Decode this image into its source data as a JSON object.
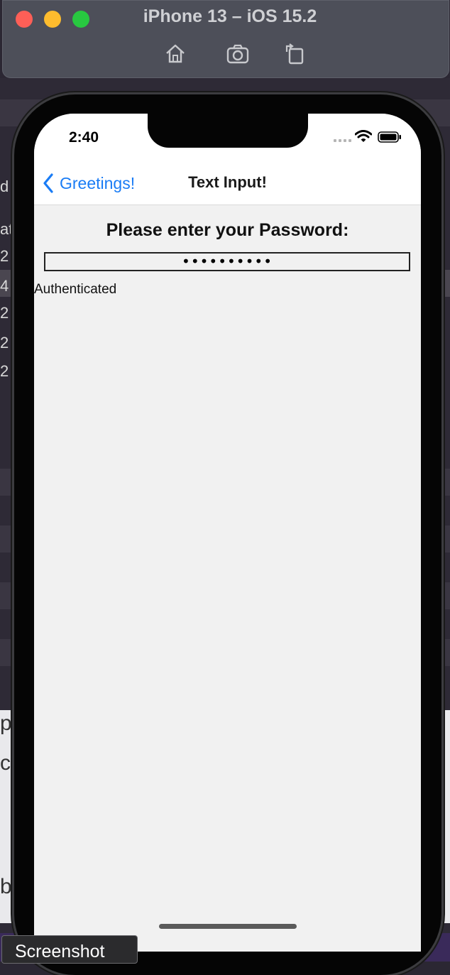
{
  "simulator": {
    "title": "iPhone 13 – iOS 15.2",
    "toolbar": [
      "home-icon",
      "screenshot-icon",
      "rotate-icon"
    ]
  },
  "background_fragments": [
    "d",
    "at",
    "2",
    "4",
    "2",
    "2",
    "2",
    "p",
    "c",
    "be"
  ],
  "status_bar": {
    "time": "2:40"
  },
  "nav": {
    "back_label": "Greetings!",
    "title": "Text Input!"
  },
  "content": {
    "prompt": "Please enter your Password:",
    "password_value": "••••••••••",
    "status_text": "Authenticated"
  },
  "tooltip": {
    "label": "Screenshot"
  },
  "colors": {
    "accent": "#1a7cf5",
    "screen_bg": "#f1f1f1",
    "titlebar": "#4d4f59"
  }
}
